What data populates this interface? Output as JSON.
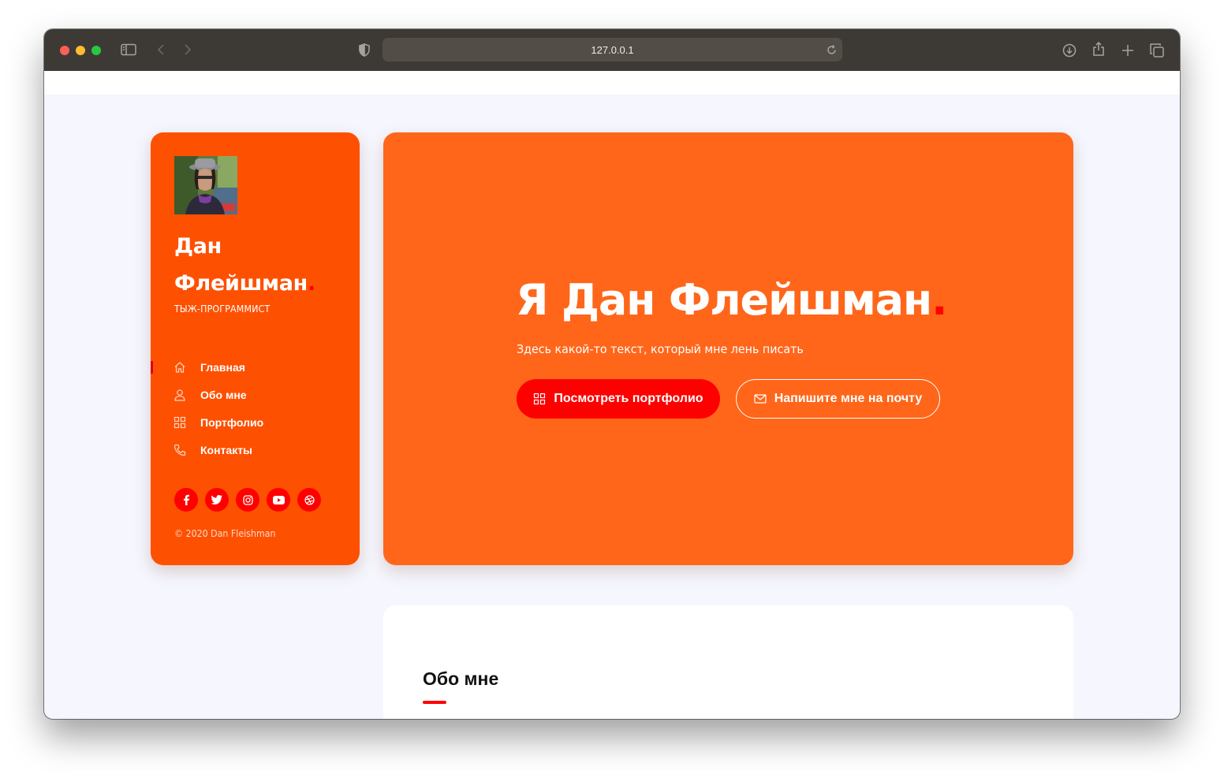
{
  "browser": {
    "url": "127.0.0.1"
  },
  "sidebar": {
    "name_line1": "Дан",
    "name_line2": "Флейшман",
    "name_dot": ".",
    "subtitle": "ТЫЖ-ПРОГРАММИСТ",
    "nav": [
      {
        "label": "Главная",
        "icon": "home-icon",
        "active": true
      },
      {
        "label": "Обо мне",
        "icon": "user-icon",
        "active": false
      },
      {
        "label": "Портфолио",
        "icon": "grid-icon",
        "active": false
      },
      {
        "label": "Контакты",
        "icon": "phone-icon",
        "active": false
      }
    ],
    "socials": [
      "facebook-icon",
      "twitter-icon",
      "instagram-icon",
      "youtube-icon",
      "dribbble-icon"
    ],
    "copyright": "© 2020 Dan Fleishman"
  },
  "hero": {
    "title": "Я Дан Флейшман",
    "title_dot": ".",
    "subtitle": "Здесь какой-то текст, который мне лень писать",
    "primary_button": "Посмотреть портфолио",
    "secondary_button": "Напишите мне на почту"
  },
  "about": {
    "title": "Обо мне"
  },
  "colors": {
    "sidebar_bg": "#fe5001",
    "hero_bg": "#ff661a",
    "accent_red": "#ff0000",
    "page_bg": "#f5f6fe"
  }
}
